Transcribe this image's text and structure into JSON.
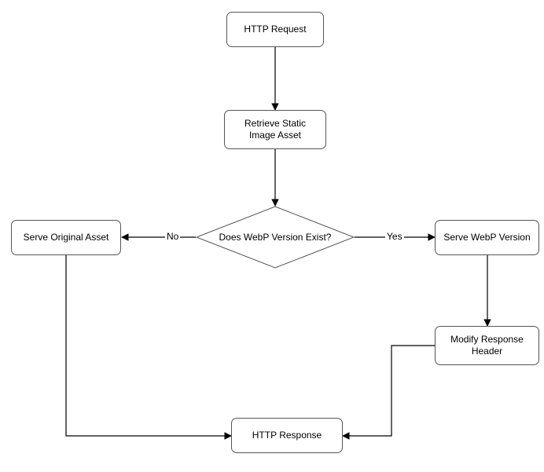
{
  "diagram": {
    "type": "flowchart",
    "nodes": {
      "http_request": {
        "label": "HTTP Request",
        "kind": "process"
      },
      "retrieve_asset": {
        "label": "Retrieve Static Image Asset",
        "kind": "process"
      },
      "decision_webp": {
        "label": "Does WebP Version Exist?",
        "kind": "decision"
      },
      "serve_original": {
        "label": "Serve Original Asset",
        "kind": "process"
      },
      "serve_webp": {
        "label": "Serve WebP Version",
        "kind": "process"
      },
      "modify_header": {
        "label": "Modify Response Header",
        "kind": "process"
      },
      "http_response": {
        "label": "HTTP Response",
        "kind": "process"
      }
    },
    "edges": [
      {
        "from": "http_request",
        "to": "retrieve_asset",
        "label": null
      },
      {
        "from": "retrieve_asset",
        "to": "decision_webp",
        "label": null
      },
      {
        "from": "decision_webp",
        "to": "serve_original",
        "label": "No"
      },
      {
        "from": "decision_webp",
        "to": "serve_webp",
        "label": "Yes"
      },
      {
        "from": "serve_webp",
        "to": "modify_header",
        "label": null
      },
      {
        "from": "serve_original",
        "to": "http_response",
        "label": null
      },
      {
        "from": "modify_header",
        "to": "http_response",
        "label": null
      }
    ]
  }
}
